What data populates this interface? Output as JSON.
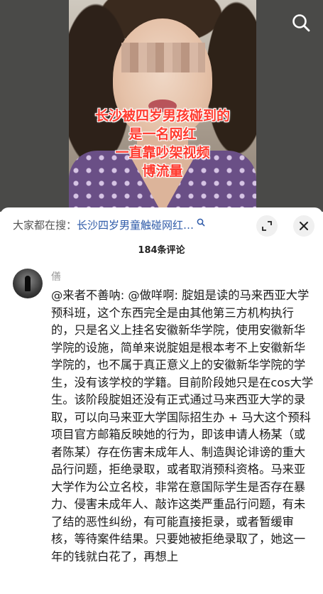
{
  "video": {
    "caption_lines": [
      "长沙被四岁男孩碰到的",
      "是一名网红",
      "一直靠吵架视频",
      "博流量"
    ],
    "search_icon": "search-icon"
  },
  "comments_panel": {
    "suggest_prefix": "大家都在搜：",
    "suggest_term": "长沙四岁男童触碰网红…",
    "expand_icon": "expand-icon",
    "close_icon": "close-icon",
    "comment_count": "184条评论"
  },
  "comment": {
    "username": "僐",
    "text": "@来者不善呐: @做咩啊: 腚姐是读的马来西亚大学预科班，这个东西完全是由其他第三方机构执行的，只是名义上挂名安徽新华学院，使用安徽新华学院的设施，简单来说腚姐是根本考不上安徽新华学院的，也不属于真正意义上的安徽新华学院的学生，没有该学校的学籍。目前阶段她只是在cos大学生。该阶段腚姐还没有正式通过马来西亚大学的录取，可以向马来亚大学国际招生办 + 马大这个预科项目官方邮箱反映她的行为，即该申请人杨某（或者陈某）存在伤害未成年人、制造舆论诽谤的重大品行问题，拒绝录取，或者取消预科资格。马来亚大学作为公立名校，非常在意国际学生是否存在暴力、侵害未成年人、敲诈这类严重品行问题，有未了结的恶性纠纷，有可能直接拒录，或者暂缓审核，等待案件结果。只要她被拒绝录取了，她这一年的钱就白花了，再想上"
  }
}
